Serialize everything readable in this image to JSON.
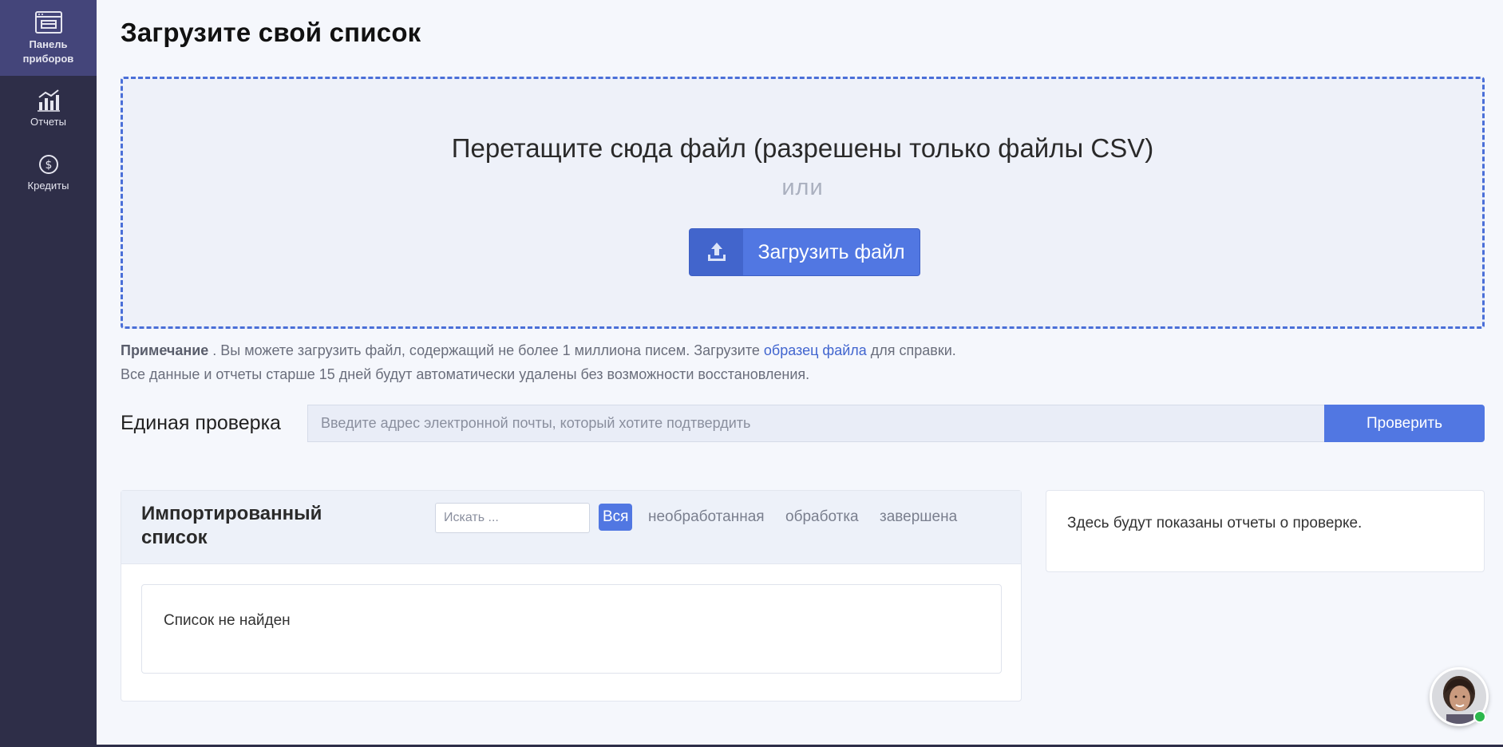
{
  "sidebar": {
    "items": [
      {
        "label": "Панель приборов",
        "icon": "dashboard-icon",
        "active": true
      },
      {
        "label": "Отчеты",
        "icon": "bar-chart-icon"
      },
      {
        "label": "Кредиты",
        "icon": "dollar-circle-icon"
      }
    ]
  },
  "page": {
    "title": "Загрузите свой список"
  },
  "dropzone": {
    "text": "Перетащите сюда файл (разрешены только файлы CSV)",
    "or": "или",
    "upload_label": "Загрузить файл",
    "upload_icon": "upload-icon"
  },
  "note": {
    "bold": "Примечание",
    "text1": " . Вы можете загрузить файл, содержащий не более 1 миллиона писем. Загрузите ",
    "link": "образец файла",
    "text2": " для справки.",
    "line2": "Все данные и отчеты старше 15 дней будут автоматически удалены без возможности восстановления."
  },
  "single_check": {
    "label": "Единая проверка",
    "placeholder": "Введите адрес электронной почты, который хотите подтвердить",
    "value": "",
    "button": "Проверить"
  },
  "imported_list": {
    "title": "Импортированный список",
    "search_placeholder": "Искать ...",
    "filters": [
      "Вся",
      "необработанная",
      "обработка",
      "завершена"
    ],
    "active_filter": "Вся",
    "empty_text": "Список не найден"
  },
  "report_panel": {
    "text": "Здесь будут показаны отчеты о проверке."
  },
  "colors": {
    "accent": "#5177e2",
    "sidebar": "#2e2e48",
    "sidebar_active": "#44457a",
    "online": "#2db84c"
  }
}
